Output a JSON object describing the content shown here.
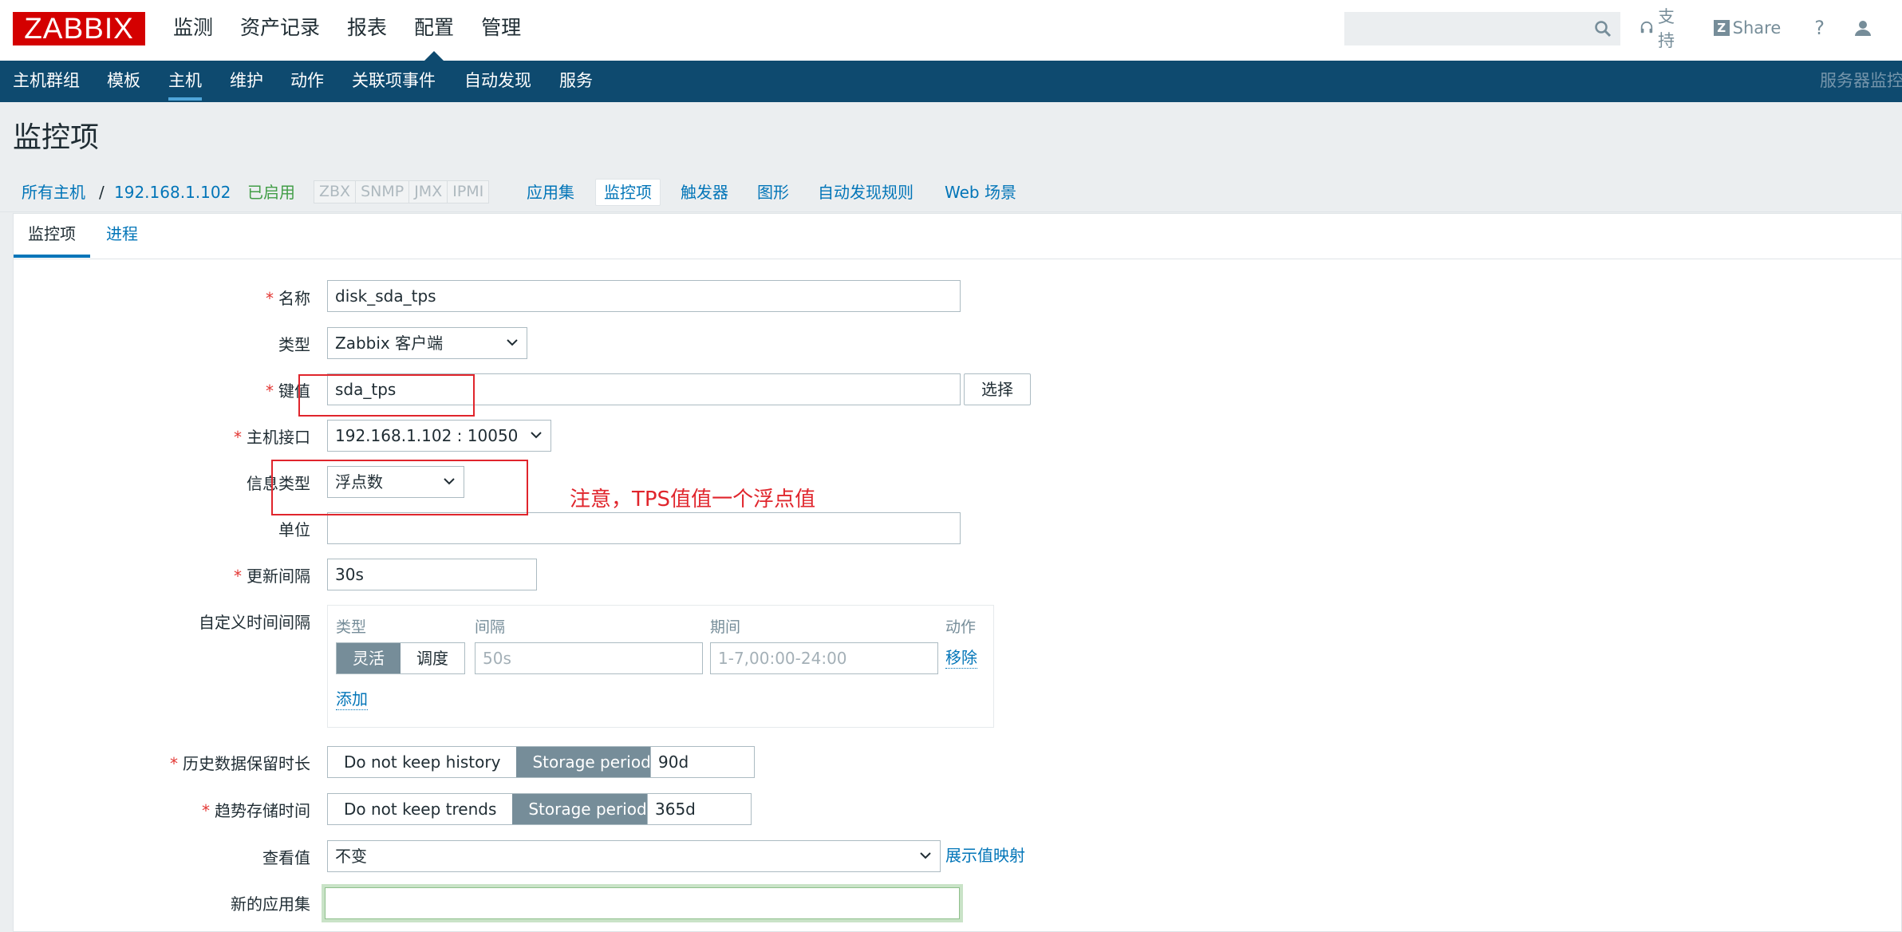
{
  "header": {
    "logo": "ZABBIX",
    "menu": [
      "监测",
      "资产记录",
      "报表",
      "配置",
      "管理"
    ],
    "active_menu": "配置",
    "search_placeholder": "",
    "support": "支持",
    "share": "Share",
    "help": "?"
  },
  "subnav": {
    "items": [
      "主机群组",
      "模板",
      "主机",
      "维护",
      "动作",
      "关联项事件",
      "自动发现",
      "服务"
    ],
    "active": "主机",
    "right_label": "服务器监控"
  },
  "page": {
    "title": "监控项"
  },
  "breadcrumb": {
    "all_hosts": "所有主机",
    "sep": "/",
    "host": "192.168.1.102",
    "status": "已启用",
    "tags": [
      "ZBX",
      "SNMP",
      "JMX",
      "IPMI"
    ],
    "links": [
      "应用集",
      "监控项",
      "触发器",
      "图形",
      "自动发现规则",
      "Web 场景"
    ],
    "active_link": "监控项"
  },
  "tabs": [
    "监控项",
    "进程"
  ],
  "form": {
    "name": {
      "label": "名称",
      "value": "disk_sda_tps"
    },
    "type": {
      "label": "类型",
      "value": "Zabbix 客户端"
    },
    "key": {
      "label": "键值",
      "value": "sda_tps",
      "button": "选择"
    },
    "interface": {
      "label": "主机接口",
      "value": "192.168.1.102 : 10050"
    },
    "info_type": {
      "label": "信息类型",
      "value": "浮点数"
    },
    "units": {
      "label": "单位",
      "value": ""
    },
    "update_interval": {
      "label": "更新间隔",
      "value": "30s"
    },
    "custom_intervals": {
      "label": "自定义时间间隔",
      "headers": [
        "类型",
        "间隔",
        "期间",
        "动作"
      ],
      "mode_options": [
        "灵活",
        "调度"
      ],
      "mode_selected": "灵活",
      "interval_placeholder": "50s",
      "period_placeholder": "1-7,00:00-24:00",
      "remove": "移除",
      "add": "添加"
    },
    "history": {
      "label": "历史数据保留时长",
      "options": [
        "Do not keep history",
        "Storage period"
      ],
      "selected": "Storage period",
      "value": "90d"
    },
    "trends": {
      "label": "趋势存储时间",
      "options": [
        "Do not keep trends",
        "Storage period"
      ],
      "selected": "Storage period",
      "value": "365d"
    },
    "valuemap": {
      "label": "查看值",
      "value": "不变",
      "link": "展示值映射"
    },
    "new_app": {
      "label": "新的应用集",
      "value": ""
    }
  },
  "annotation": {
    "text": "注意，TPS值值一个浮点值",
    "color": "#e0252c"
  },
  "colors": {
    "nav": "#0e4a6f",
    "link": "#0275b8",
    "logo": "#d40000",
    "enabled": "#429e47"
  }
}
